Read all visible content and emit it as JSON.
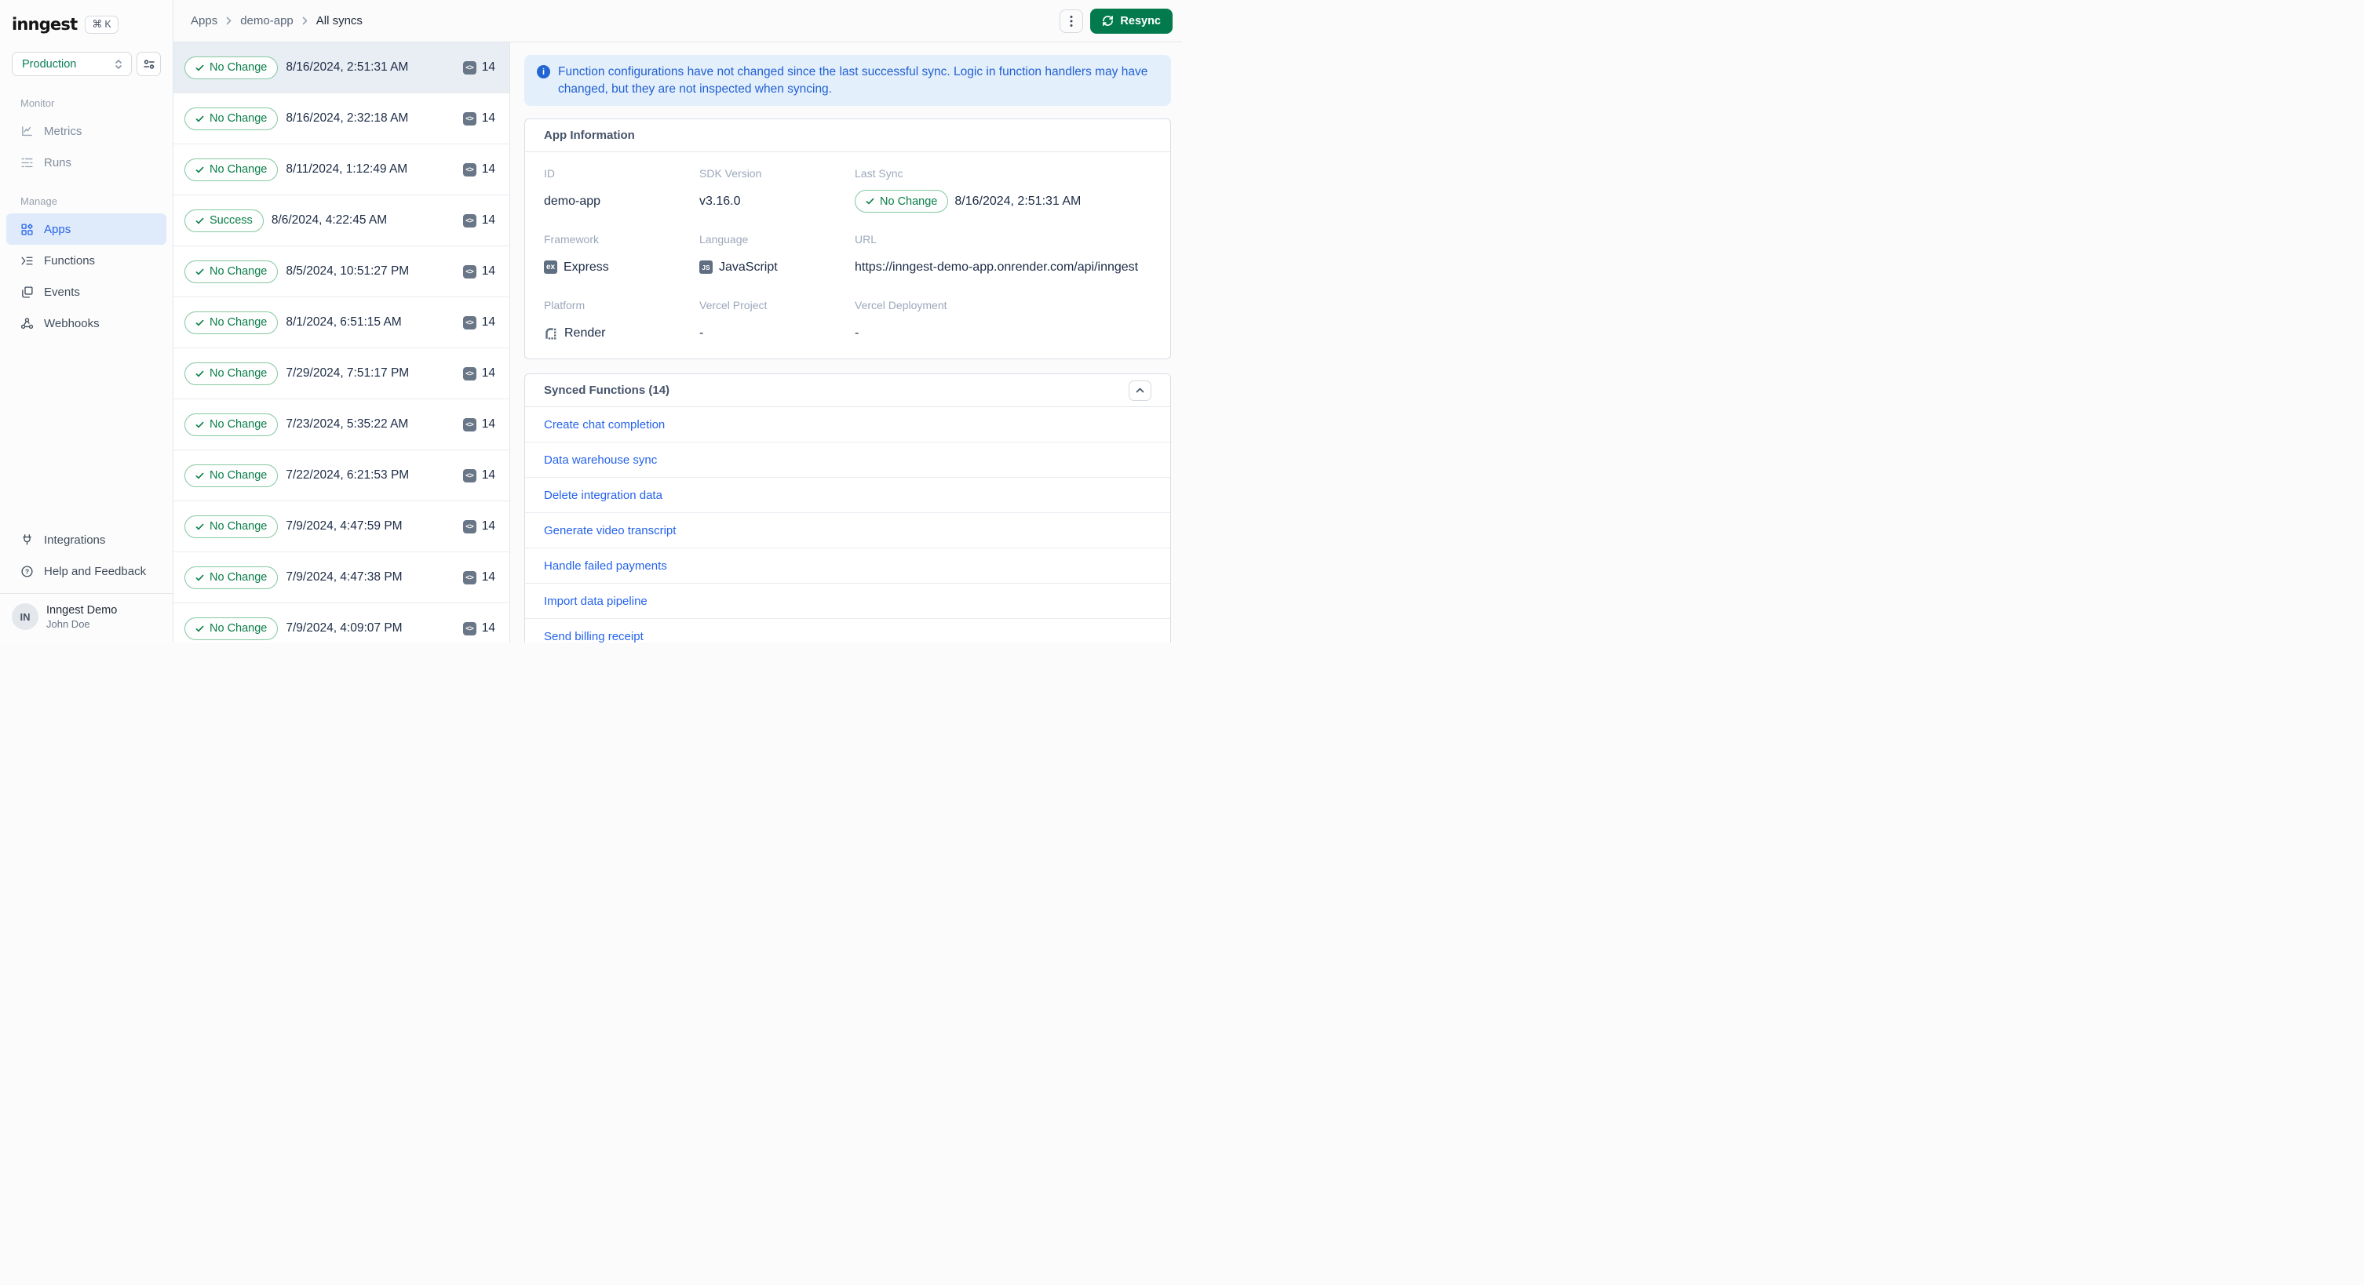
{
  "app": {
    "logo": "inngest",
    "kbd_cmd": "⌘",
    "kbd_key": "K"
  },
  "env_selector": {
    "value": "Production"
  },
  "sidebar": {
    "sections": [
      {
        "label": "Monitor",
        "items": [
          {
            "label": "Metrics"
          },
          {
            "label": "Runs"
          }
        ]
      },
      {
        "label": "Manage",
        "items": [
          {
            "label": "Apps",
            "active": true
          },
          {
            "label": "Functions"
          },
          {
            "label": "Events"
          },
          {
            "label": "Webhooks"
          }
        ]
      }
    ],
    "footer": [
      {
        "label": "Integrations"
      },
      {
        "label": "Help and Feedback"
      }
    ],
    "user": {
      "initials": "IN",
      "org": "Inngest Demo",
      "name": "John Doe"
    }
  },
  "breadcrumb": {
    "items": [
      "Apps",
      "demo-app",
      "All syncs"
    ]
  },
  "header": {
    "resync_label": "Resync"
  },
  "syncs": {
    "items": [
      {
        "status": "No Change",
        "timestamp": "8/16/2024, 2:51:31 AM",
        "count": "14",
        "selected": true
      },
      {
        "status": "No Change",
        "timestamp": "8/16/2024, 2:32:18 AM",
        "count": "14"
      },
      {
        "status": "No Change",
        "timestamp": "8/11/2024, 1:12:49 AM",
        "count": "14"
      },
      {
        "status": "Success",
        "timestamp": "8/6/2024, 4:22:45 AM",
        "count": "14"
      },
      {
        "status": "No Change",
        "timestamp": "8/5/2024, 10:51:27 PM",
        "count": "14"
      },
      {
        "status": "No Change",
        "timestamp": "8/1/2024, 6:51:15 AM",
        "count": "14"
      },
      {
        "status": "No Change",
        "timestamp": "7/29/2024, 7:51:17 PM",
        "count": "14"
      },
      {
        "status": "No Change",
        "timestamp": "7/23/2024, 5:35:22 AM",
        "count": "14"
      },
      {
        "status": "No Change",
        "timestamp": "7/22/2024, 6:21:53 PM",
        "count": "14"
      },
      {
        "status": "No Change",
        "timestamp": "7/9/2024, 4:47:59 PM",
        "count": "14"
      },
      {
        "status": "No Change",
        "timestamp": "7/9/2024, 4:47:38 PM",
        "count": "14"
      },
      {
        "status": "No Change",
        "timestamp": "7/9/2024, 4:09:07 PM",
        "count": "14"
      }
    ]
  },
  "banner": {
    "text": "Function configurations have not changed since the last successful sync. Logic in function handlers may have changed, but they are not inspected when syncing."
  },
  "app_info": {
    "title": "App Information",
    "id_label": "ID",
    "id": "demo-app",
    "sdk_label": "SDK Version",
    "sdk": "v3.16.0",
    "last_sync_label": "Last Sync",
    "last_sync_status": "No Change",
    "last_sync_time": "8/16/2024, 2:51:31 AM",
    "framework_label": "Framework",
    "framework_badge": "ex",
    "framework": "Express",
    "language_label": "Language",
    "language_badge": "JS",
    "language": "JavaScript",
    "url_label": "URL",
    "url": "https://inngest-demo-app.onrender.com/api/inngest",
    "platform_label": "Platform",
    "platform": "Render",
    "vercel_project_label": "Vercel Project",
    "vercel_project": "-",
    "vercel_deployment_label": "Vercel Deployment",
    "vercel_deployment": "-"
  },
  "synced_functions": {
    "title": "Synced Functions (14)",
    "items": [
      "Create chat completion",
      "Data warehouse sync",
      "Delete integration data",
      "Generate video transcript",
      "Handle failed payments",
      "Import data pipeline",
      "Send billing receipt"
    ]
  },
  "colors": {
    "accent_green": "#027A4E",
    "badge_green": "#0B7D4B",
    "badge_border": "#86C8A3",
    "link_blue": "#2563EB",
    "banner_text": "#2161D1",
    "banner_bg": "#E4EFFC",
    "selected_row_bg": "#E9EEF4"
  }
}
